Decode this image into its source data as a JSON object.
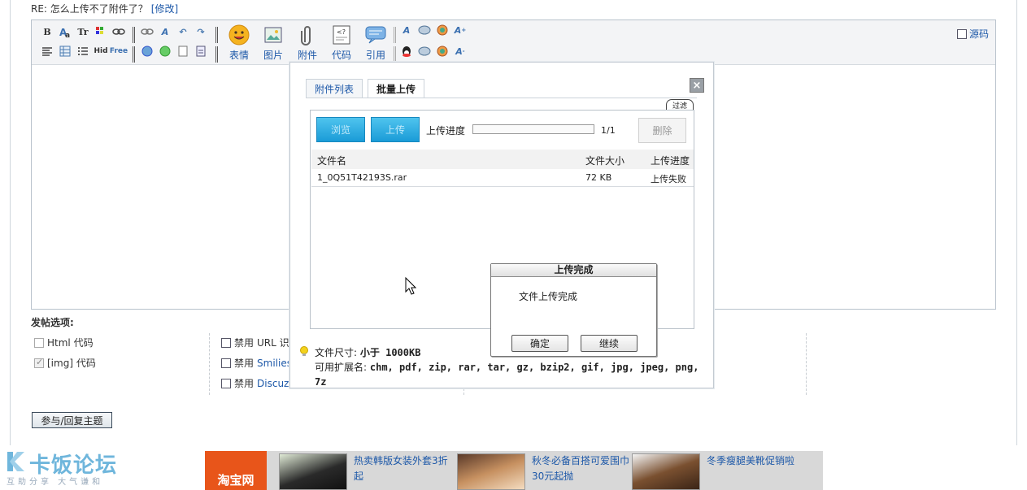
{
  "reply": {
    "title": "RE: 怎么上传不了附件了？",
    "edit_link": "[修改]"
  },
  "toolbar": {
    "row1_icons": [
      "bold-icon",
      "font-icon",
      "font-size-icon",
      "color-icon",
      "link-icon"
    ],
    "row2_icons": [
      "align-icon",
      "table-icon",
      "list-icon",
      "hide-icon",
      "free-icon"
    ],
    "big_tools": [
      {
        "label": "表情",
        "icon": "smiley-icon"
      },
      {
        "label": "图片",
        "icon": "image-icon"
      },
      {
        "label": "附件",
        "icon": "attachment-icon"
      },
      {
        "label": "代码",
        "icon": "code-icon"
      },
      {
        "label": "引用",
        "icon": "quote-icon"
      }
    ],
    "source_label": "源码"
  },
  "options": {
    "heading": "发帖选项:",
    "html_code": "Html 代码",
    "img_code": "[img] 代码",
    "disable1_prefix": "禁用",
    "disable1_text": "URL 识",
    "disable2_prefix": "禁用",
    "disable2_link": "Smilies",
    "disable3_prefix": "禁用",
    "disable3_link": "Discuz"
  },
  "submit_label": "参与/回复主题",
  "dialog": {
    "tab_list": "附件列表",
    "tab_batch": "批量上传",
    "close_glyph": "×",
    "filter_tag": "过滤",
    "browse_label": "浏览",
    "upload_label": "上传",
    "progress_label": "上传进度",
    "progress_count": "1/1",
    "progress_fraction": 0,
    "delete_label": "删除",
    "columns": {
      "name": "文件名",
      "size": "文件大小",
      "status": "上传进度"
    },
    "rows": [
      {
        "name": "1_0Q51T42193S.rar",
        "size": "72 KB",
        "status": "上传失败"
      }
    ],
    "hint_size_label": "文件尺寸:",
    "hint_size_value": "小于 1000KB",
    "hint_ext_label": "可用扩展名:",
    "hint_ext_value": "chm, pdf, zip, rar, tar, gz, bzip2, gif, jpg, jpeg, png, 7z"
  },
  "msgbox": {
    "title": "上传完成",
    "text": "文件上传完成",
    "ok_label": "确定",
    "continue_label": "继续"
  },
  "footer": {
    "logo_main": "卡饭论坛",
    "logo_sub": "互助分享 大气谦和",
    "taobao": "淘宝网",
    "ads": [
      {
        "text": "热卖韩版女装外套3折起"
      },
      {
        "text": "秋冬必备百搭可爱围巾30元起抛"
      },
      {
        "text": "冬季瘦腿美靴促销啦"
      }
    ]
  },
  "colors": {
    "link": "#1d58a8",
    "upload_button": "#1a9bd7",
    "taobao": "#e8551a"
  }
}
